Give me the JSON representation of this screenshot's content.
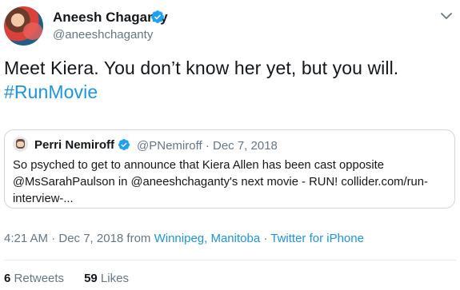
{
  "tweet": {
    "author": {
      "name": "Aneesh Chaganty",
      "handle": "@aneeshchaganty",
      "verified_icon": "verified-badge-icon"
    },
    "text": "Meet Kiera. You don’t know her yet, but you will.",
    "hashtag": "#RunMovie",
    "menu_icon": "chevron-down-icon",
    "quoted": {
      "name": "Perri Nemiroff",
      "verified_icon": "verified-badge-icon",
      "handle": "@PNemiroff",
      "separator": "·",
      "date": "Dec 7, 2018",
      "text_line1": "So psyched to get to announce that Kiera Allen has been cast opposite",
      "text_line2": "@MsSarahPaulson in @aneeshchaganty's next movie - RUN! collider.com/run-",
      "text_line3": "interview-..."
    },
    "meta": {
      "time_date": "4:21 AM · Dec 7, 2018 from ",
      "location": "Winnipeg, Manitoba",
      "separator": " · ",
      "source": "Twitter for iPhone"
    },
    "stats": {
      "retweets_count": "6",
      "retweets_label": "Retweets",
      "likes_count": "59",
      "likes_label": "Likes"
    },
    "colors": {
      "link": "#1b95e0",
      "verified": "#1da1f2",
      "secondary_text": "#657786"
    }
  }
}
